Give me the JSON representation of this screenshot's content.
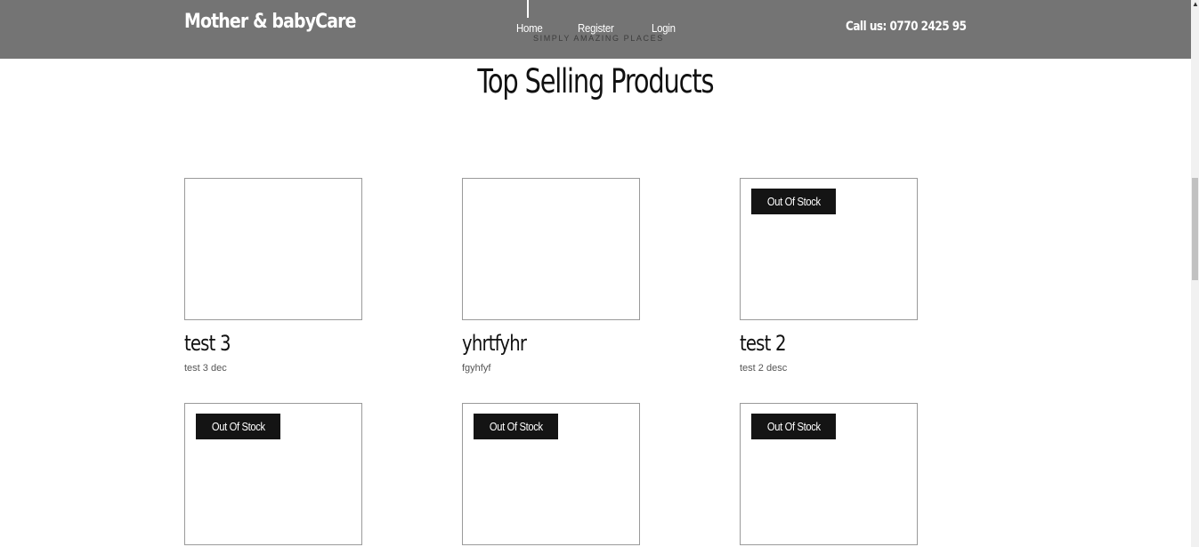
{
  "header": {
    "brand": "Mother & babyCare",
    "nav": [
      "Home",
      "Register",
      "Login"
    ],
    "tagline": "SIMPLY AMAZING PLACES",
    "phone": "Call us: 0770 2425 95"
  },
  "main": {
    "title": "Top Selling Products",
    "products": [
      {
        "name": "test 3",
        "description": "test 3 dec",
        "badge": ""
      },
      {
        "name": "yhrtfyhr",
        "description": "fgyhfyf",
        "badge": ""
      },
      {
        "name": "test 2",
        "description": "test 2 desc",
        "badge": "Out Of Stock"
      },
      {
        "name": "",
        "description": "",
        "badge": "Out Of Stock"
      },
      {
        "name": "",
        "description": "",
        "badge": "Out Of Stock"
      },
      {
        "name": "",
        "description": "",
        "badge": "Out Of Stock"
      }
    ]
  },
  "colors": {
    "header_bg": "#747474",
    "badge_bg": "#141414",
    "text": "#111111"
  }
}
